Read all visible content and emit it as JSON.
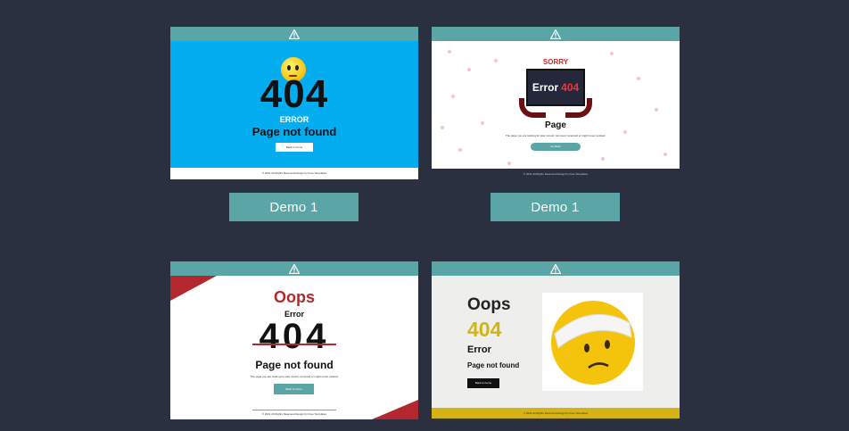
{
  "demo1": {
    "big_number": "404",
    "error_label": "ERROR",
    "message": "Page not found",
    "button": "Back to home",
    "footer": "© 2021 All Rights Reserved Design by Free Templates",
    "demo_button": "Demo 1",
    "colors": {
      "bg": "#04adf0",
      "accent": "#5aa6a6"
    }
  },
  "demo2": {
    "sorry": "SORRY",
    "screen_text": "Error",
    "screen_number": "404",
    "page_label": "Page",
    "sub_text": "The page you are looking for was moved, removed, renamed or might never existed.",
    "button": "Go Back",
    "footer": "© 2021 All Rights Reserved Design by Free Templates",
    "demo_button": "Demo 1"
  },
  "demo3": {
    "oops": "Oops",
    "error": "Error",
    "digits": [
      "4",
      "0",
      "4"
    ],
    "message": "Page not found",
    "sub_text": "The page you are looking for was moved, removed or might never existed.",
    "button": "Back to home",
    "footer": "© 2021 All Rights Reserved Design by Free Templates"
  },
  "demo4": {
    "oops": "Oops",
    "number": "404",
    "error": "Error",
    "message": "Page not found",
    "button": "Back to home",
    "footer": "© 2021 All Rights Reserved Design by Free Templates",
    "colors": {
      "number": "#d4b414",
      "footer": "#d4b414"
    }
  }
}
